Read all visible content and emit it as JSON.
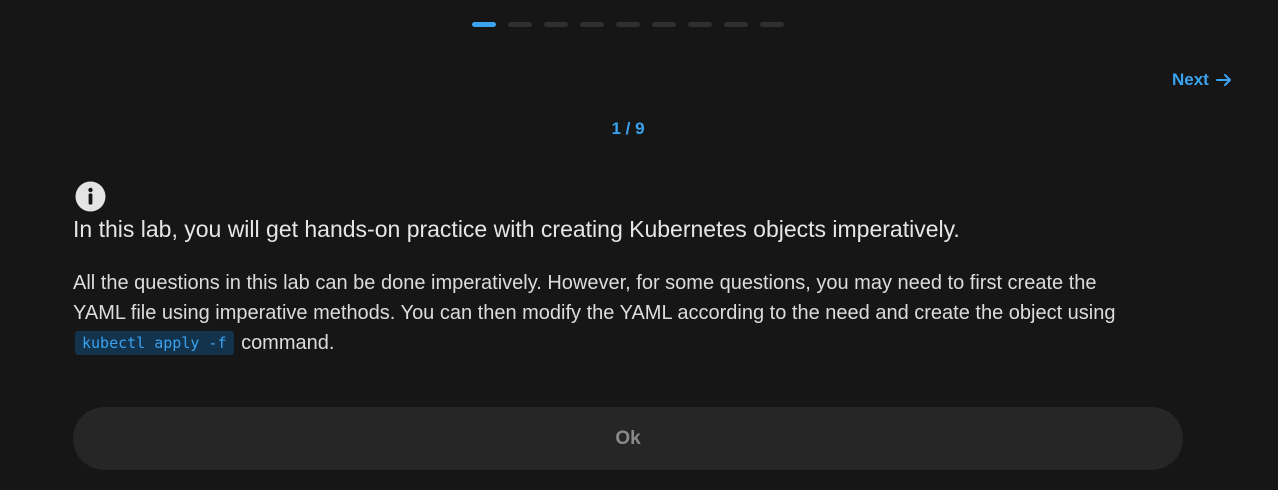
{
  "steps": {
    "total": 9,
    "current": 1
  },
  "navigation": {
    "next_label": "Next"
  },
  "counter": "1 / 9",
  "intro": {
    "heading": "In this lab, you will get hands-on practice with creating Kubernetes objects imperatively.",
    "body_part1": "All the questions in this lab can be done imperatively. However, for some questions, you may need to first create the YAML file using imperative methods. You can then modify the YAML according to the need and create the object using",
    "code": "kubectl apply -f",
    "body_part2": "command."
  },
  "ok_label": "Ok",
  "colors": {
    "accent": "#3aa3f0",
    "background": "#161616",
    "button": "#262626"
  },
  "icons": {
    "info": "info-icon",
    "next": "arrow-right-icon"
  }
}
